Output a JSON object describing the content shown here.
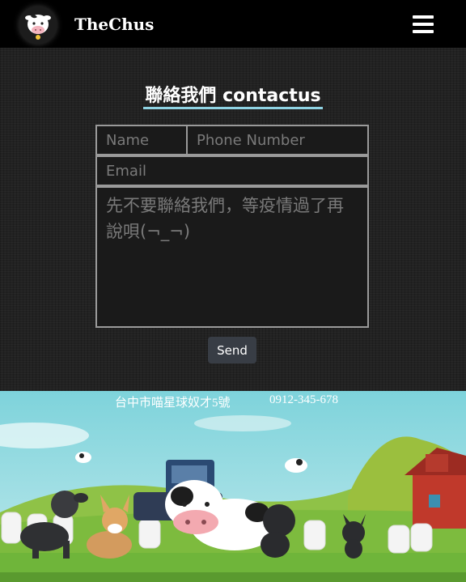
{
  "navbar": {
    "brand": "TheChus"
  },
  "contact": {
    "title": "聯絡我們 contactus",
    "name_placeholder": "Name",
    "phone_placeholder": "Phone Number",
    "email_placeholder": "Email",
    "message_placeholder": "先不要聯絡我們，等疫情過了再說唄(¬_¬)",
    "send_label": "Send"
  },
  "footer": {
    "address": "台中市喵星球奴才5號",
    "phone": "0912-345-678"
  },
  "colors": {
    "navbar_bg": "#000000",
    "title_underline": "#8fd3e3",
    "send_button": "#383d45",
    "sky": "#74cfd8",
    "grass": "#6fb53a"
  }
}
